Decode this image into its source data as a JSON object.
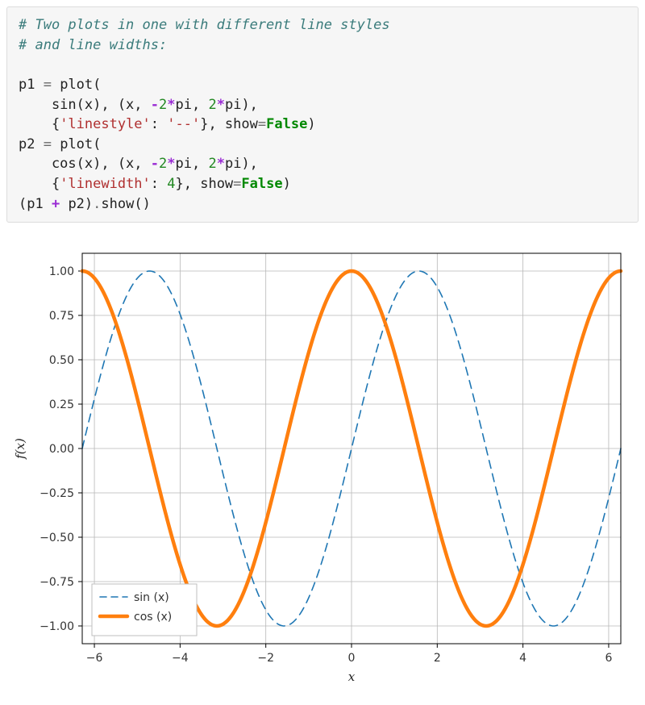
{
  "code": {
    "l1": "# Two plots in one with different line styles",
    "l2": "# and line widths:",
    "l4a": "p1 ",
    "l4b": "=",
    "l4c": " plot(",
    "l5a": "    sin(x), (x, ",
    "l5b": "-",
    "l5c": "2",
    "l5d": "*",
    "l5e": "pi, ",
    "l5f": "2",
    "l5g": "*",
    "l5h": "pi),",
    "l6a": "    {",
    "l6b": "'linestyle'",
    "l6c": ": ",
    "l6d": "'--'",
    "l6e": "}, show",
    "l6f": "=",
    "l6g": "False",
    "l6h": ")",
    "l7a": "p2 ",
    "l7b": "=",
    "l7c": " plot(",
    "l8a": "    cos(x), (x, ",
    "l8b": "-",
    "l8c": "2",
    "l8d": "*",
    "l8e": "pi, ",
    "l8f": "2",
    "l8g": "*",
    "l8h": "pi),",
    "l9a": "    {",
    "l9b": "'linewidth'",
    "l9c": ": ",
    "l9d": "4",
    "l9e": "}, show",
    "l9f": "=",
    "l9g": "False",
    "l9h": ")",
    "l10": "(p1 ",
    "l10b": "+",
    "l10c": " p2)",
    "l10d": ".",
    "l10e": "show()"
  },
  "chart_data": {
    "type": "line",
    "title": "",
    "xlabel": "x",
    "ylabel": "f(x)",
    "xlim": [
      -6.2832,
      6.2832
    ],
    "ylim": [
      -1.1,
      1.1
    ],
    "xticks": [
      -6,
      -4,
      -2,
      0,
      2,
      4,
      6
    ],
    "xticklabels": [
      "−6",
      "−4",
      "−2",
      "0",
      "2",
      "4",
      "6"
    ],
    "yticks": [
      -1.0,
      -0.75,
      -0.5,
      -0.25,
      0.0,
      0.25,
      0.5,
      0.75,
      1.0
    ],
    "yticklabels": [
      "−1.00",
      "−0.75",
      "−0.50",
      "−0.25",
      "0.00",
      "0.25",
      "0.50",
      "0.75",
      "1.00"
    ],
    "series": [
      {
        "name": "sin (x)",
        "color": "#1f77b4",
        "linestyle": "--",
        "linewidth": 1.6,
        "func": "sin"
      },
      {
        "name": "cos (x)",
        "color": "#ff7f0e",
        "linestyle": "-",
        "linewidth": 4.5,
        "func": "cos"
      }
    ],
    "legend": {
      "loc": "lower left"
    }
  }
}
